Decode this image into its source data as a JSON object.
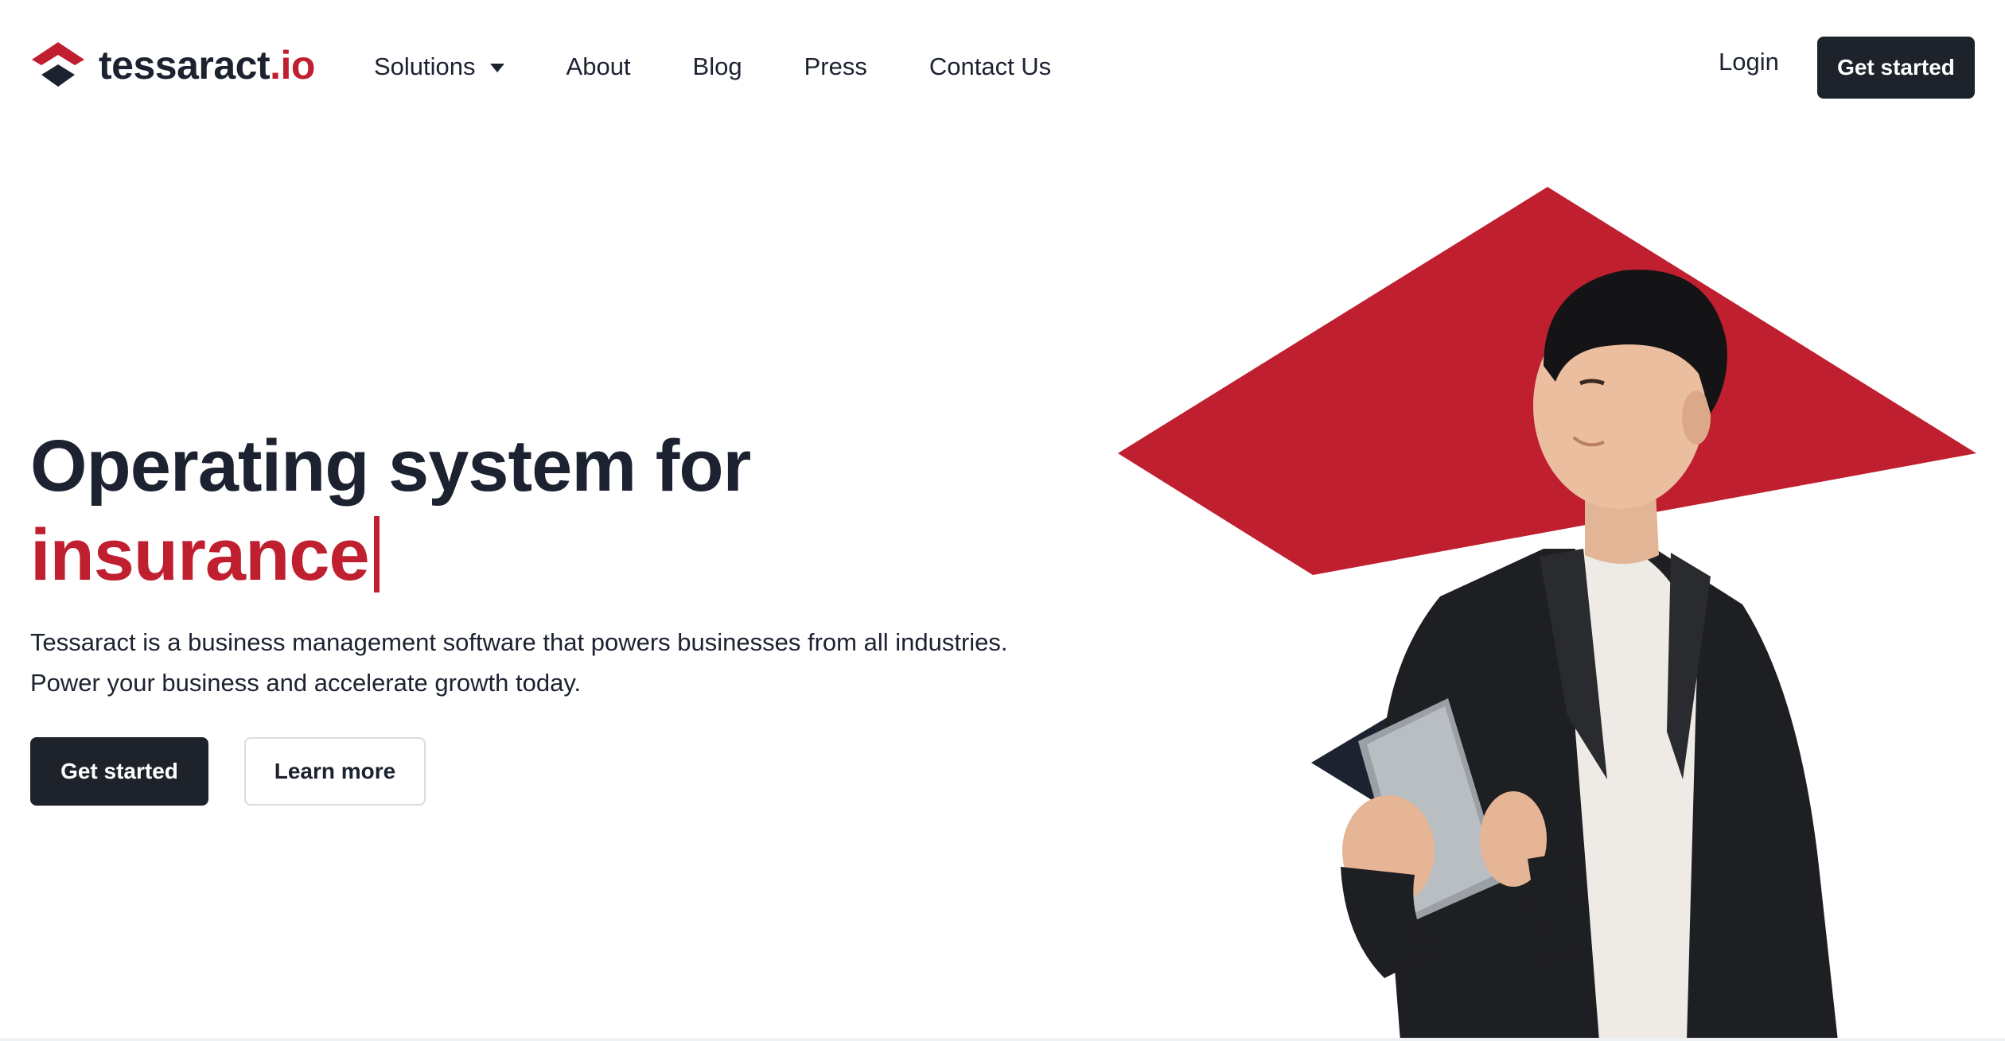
{
  "brand": {
    "name": "tessaract",
    "tld": ".io",
    "accent_color": "#c01f2f",
    "dark_color": "#1d222b"
  },
  "nav": {
    "items": [
      {
        "label": "Solutions",
        "has_dropdown": true
      },
      {
        "label": "About"
      },
      {
        "label": "Blog"
      },
      {
        "label": "Press"
      },
      {
        "label": "Contact Us"
      }
    ],
    "login_label": "Login",
    "cta_label": "Get started"
  },
  "hero": {
    "title_line1": "Operating system for",
    "title_highlight": "insurance",
    "description_line1": "Tessaract is a business management software that powers businesses from all industries.",
    "description_line2": "Power your business and accelerate growth today.",
    "primary_cta": "Get started",
    "secondary_cta": "Learn more"
  },
  "icons": {
    "logo": "tessaract-logo-icon",
    "dropdown": "caret-down-icon"
  }
}
